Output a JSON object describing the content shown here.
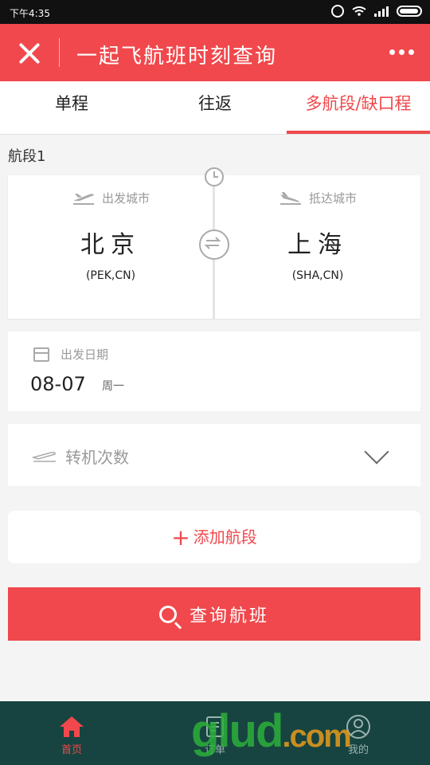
{
  "status_bar": {
    "time": "下午4:35"
  },
  "header": {
    "title": "一起飞航班时刻查询"
  },
  "tabs": [
    {
      "label": "单程"
    },
    {
      "label": "往返"
    },
    {
      "label": "多航段/缺口程"
    }
  ],
  "segment": {
    "label": "航段1",
    "departure": {
      "hint": "出发城市",
      "city": "北京",
      "code": "(PEK,CN)"
    },
    "arrival": {
      "hint": "抵达城市",
      "city": "上海",
      "code": "(SHA,CN)"
    },
    "date": {
      "hint": "出发日期",
      "value": "08-07",
      "weekday": "周一"
    },
    "transfer": {
      "label": "转机次数"
    }
  },
  "add_segment": {
    "label": "添加航段"
  },
  "search_button": {
    "label": "查询航班"
  },
  "bottom_nav": [
    {
      "label": "首页"
    },
    {
      "label": "订单"
    },
    {
      "label": "我的"
    }
  ],
  "watermark": {
    "text": "glud",
    "tld": ".com"
  },
  "colors": {
    "accent": "#f0484c",
    "nav_bg": "#174440"
  }
}
